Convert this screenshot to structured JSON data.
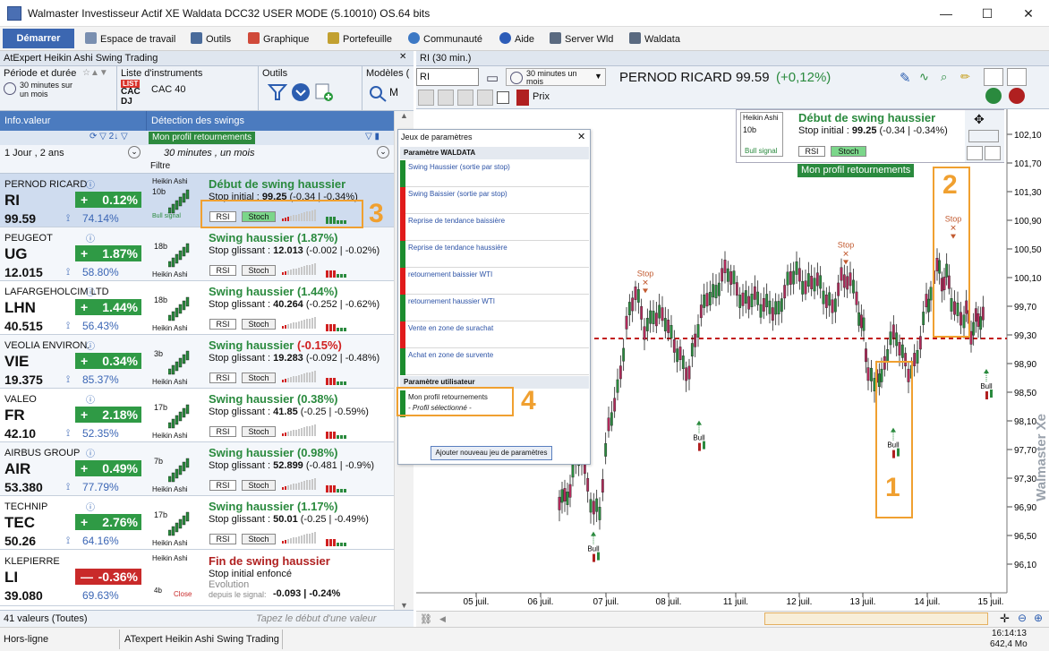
{
  "app_title": "Walmaster Investisseur Actif XE Waldata DCC32 USER MODE (5.10010) OS.64 bits",
  "window_controls": {
    "minimize": "—",
    "maximize": "☐",
    "close": "✕"
  },
  "menu": {
    "start": "Démarrer",
    "items": [
      "Espace de travail",
      "Outils",
      "Graphique",
      "Portefeuille",
      "Communauté",
      "Aide",
      "Server Wld",
      "Waldata"
    ]
  },
  "left_panel": {
    "title": "AtExpert Heikin Ashi Swing Trading",
    "period_label": "Période et durée",
    "period_value": "30 minutes sur un mois",
    "instruments_label": "Liste d'instruments",
    "instruments_value": "CAC 40",
    "instrument_codes": [
      "LIST",
      "CAC",
      "DJ"
    ],
    "tools_label": "Outils",
    "models_label": "Modèles (",
    "col_info": "Info.valeur",
    "col_detect": "Détection des swings",
    "profile_tag": "Mon profil retournements",
    "period_short": "1 Jour , 2 ans",
    "period_detect": "30 minutes , un mois",
    "filter": "Filtre",
    "rsi": "RSI",
    "stoch": "Stoch",
    "heikin": "Heikin Ashi",
    "rows": [
      {
        "name": "PERNOD RICARD",
        "code": "RI",
        "price": "99.59",
        "change": "0.12%",
        "sign": "+",
        "up": true,
        "vol": "74.14%",
        "mini": "10b",
        "signal": "Début de swing haussier",
        "stop": "Stop initial : ",
        "stop_val": "99.25",
        "stop_rest": " (-0.34 | -0.34%)",
        "status_color": "#2a8a3e"
      },
      {
        "name": "PEUGEOT",
        "code": "UG",
        "price": "12.015",
        "change": "1.87%",
        "sign": "+",
        "up": true,
        "vol": "58.80%",
        "mini": "18b",
        "signal": "Swing haussier (1.87%)",
        "stop": "Stop glissant : ",
        "stop_val": "12.013",
        "stop_rest": " (-0.002 | -0.02%)",
        "status_color": "#2a8a3e"
      },
      {
        "name": "LAFARGEHOLCIM LTD",
        "code": "LHN",
        "price": "40.515",
        "change": "1.44%",
        "sign": "+",
        "up": true,
        "vol": "56.43%",
        "mini": "18b",
        "signal": "Swing haussier (1.44%)",
        "stop": "Stop glissant : ",
        "stop_val": "40.264",
        "stop_rest": " (-0.252 | -0.62%)",
        "status_color": "#2a8a3e"
      },
      {
        "name": "VEOLIA ENVIRON.",
        "code": "VIE",
        "price": "19.375",
        "change": "0.34%",
        "sign": "+",
        "up": true,
        "vol": "85.37%",
        "mini": "3b",
        "signal": "Swing haussier ",
        "signal_red": "(-0.15%)",
        "stop": "Stop glissant : ",
        "stop_val": "19.283",
        "stop_rest": " (-0.092 | -0.48%)",
        "status_color": "#2a8a3e"
      },
      {
        "name": "VALEO",
        "code": "FR",
        "price": "42.10",
        "change": "2.18%",
        "sign": "+",
        "up": true,
        "vol": "52.35%",
        "mini": "17b",
        "signal": "Swing haussier (0.38%)",
        "stop": "Stop glissant : ",
        "stop_val": "41.85",
        "stop_rest": " (-0.25 | -0.59%)",
        "status_color": "#2a8a3e"
      },
      {
        "name": "AIRBUS GROUP",
        "code": "AIR",
        "price": "53.380",
        "change": "0.49%",
        "sign": "+",
        "up": true,
        "vol": "77.79%",
        "mini": "7b",
        "signal": "Swing haussier (0.98%)",
        "stop": "Stop glissant : ",
        "stop_val": "52.899",
        "stop_rest": " (-0.481 | -0.9%)",
        "status_color": "#2a8a3e"
      },
      {
        "name": "TECHNIP",
        "code": "TEC",
        "price": "50.26",
        "change": "2.76%",
        "sign": "+",
        "up": true,
        "vol": "64.16%",
        "mini": "17b",
        "signal": "Swing haussier (1.17%)",
        "stop": "Stop glissant : ",
        "stop_val": "50.01",
        "stop_rest": " (-0.25 | -0.49%)",
        "status_color": "#2a8a3e"
      }
    ],
    "last_row": {
      "name": "KLEPIERRE",
      "code": "LI",
      "price": "39.080",
      "change": "-0.36%",
      "vol": "69.63%",
      "mini": "4b",
      "close": "Close",
      "signal": "Fin de swing haussier",
      "stop": "Stop initial enfoncé",
      "evo": "Evolution",
      "evo2": "depuis le signal:",
      "evo_val": "-0.093 | -0.24%"
    },
    "count": "41 valeurs (Toutes)",
    "search_placeholder": "Tapez le début d'une valeur",
    "bull_signal": "Bull signal"
  },
  "chart": {
    "tab": "RI (30 min.)",
    "symbol": "RI",
    "period": "30 minutes un mois",
    "instrument": "PERNOD RICARD",
    "last": "99.59",
    "change": "(+0,12%)",
    "prix": "Prix",
    "panel_title": "Début de swing haussier",
    "panel_stop": "Stop initial : ",
    "panel_stop_val": "99.25",
    "panel_stop_rest": " (-0.34 | -0.34%)",
    "panel_profile": "Mon profil retournements",
    "panel_mini": "10b",
    "stop_text": "Stop",
    "bull_text": "Bull",
    "watermark": "Walmaster Xe",
    "y_ticks": [
      "102,10",
      "101,70",
      "101,30",
      "100,90",
      "100,50",
      "100,10",
      "99,70",
      "99,30",
      "98,90",
      "98,50",
      "98,10",
      "97,70",
      "97,30",
      "96,90",
      "96,50",
      "96,10"
    ],
    "x_ticks": [
      "05 juil.",
      "06 juil.",
      "07 juil.",
      "08 juil.",
      "11 juil.",
      "12 juil.",
      "13 juil.",
      "14 juil.",
      "15 juil."
    ],
    "stop_level": 99.25,
    "annotations": [
      "1",
      "2",
      "3",
      "4"
    ]
  },
  "dialog": {
    "title": "Jeux de paramètres",
    "section1": "Paramètre WALDATA",
    "items": [
      {
        "label": "Swing Haussier (sortie par stop)",
        "color": "#1c8c2e"
      },
      {
        "label": "Swing Baissier (sortie par stop)",
        "color": "#e01b1b"
      },
      {
        "label": "Reprise de tendance baissière",
        "color": "#e01b1b"
      },
      {
        "label": "Reprise de tendance haussière",
        "color": "#1c8c2e"
      },
      {
        "label": "retournement baissier WTI",
        "color": "#e01b1b"
      },
      {
        "label": "retournement haussier WTI",
        "color": "#1c8c2e"
      },
      {
        "label": "Vente en zone de surachat",
        "color": "#e01b1b"
      },
      {
        "label": "Achat en zone de survente",
        "color": "#1c8c2e"
      }
    ],
    "section2": "Paramètre utilisateur",
    "user_item": "Mon profil retournements",
    "user_sub": "- Profil sélectionné -",
    "add_btn": "Ajouter nouveau jeu de paramètres"
  },
  "status": {
    "left": "Hors-ligne",
    "middle": "ATexpert Heikin Ashi Swing Trading",
    "time": "16:14:13",
    "memory": "642,4 Mo"
  }
}
